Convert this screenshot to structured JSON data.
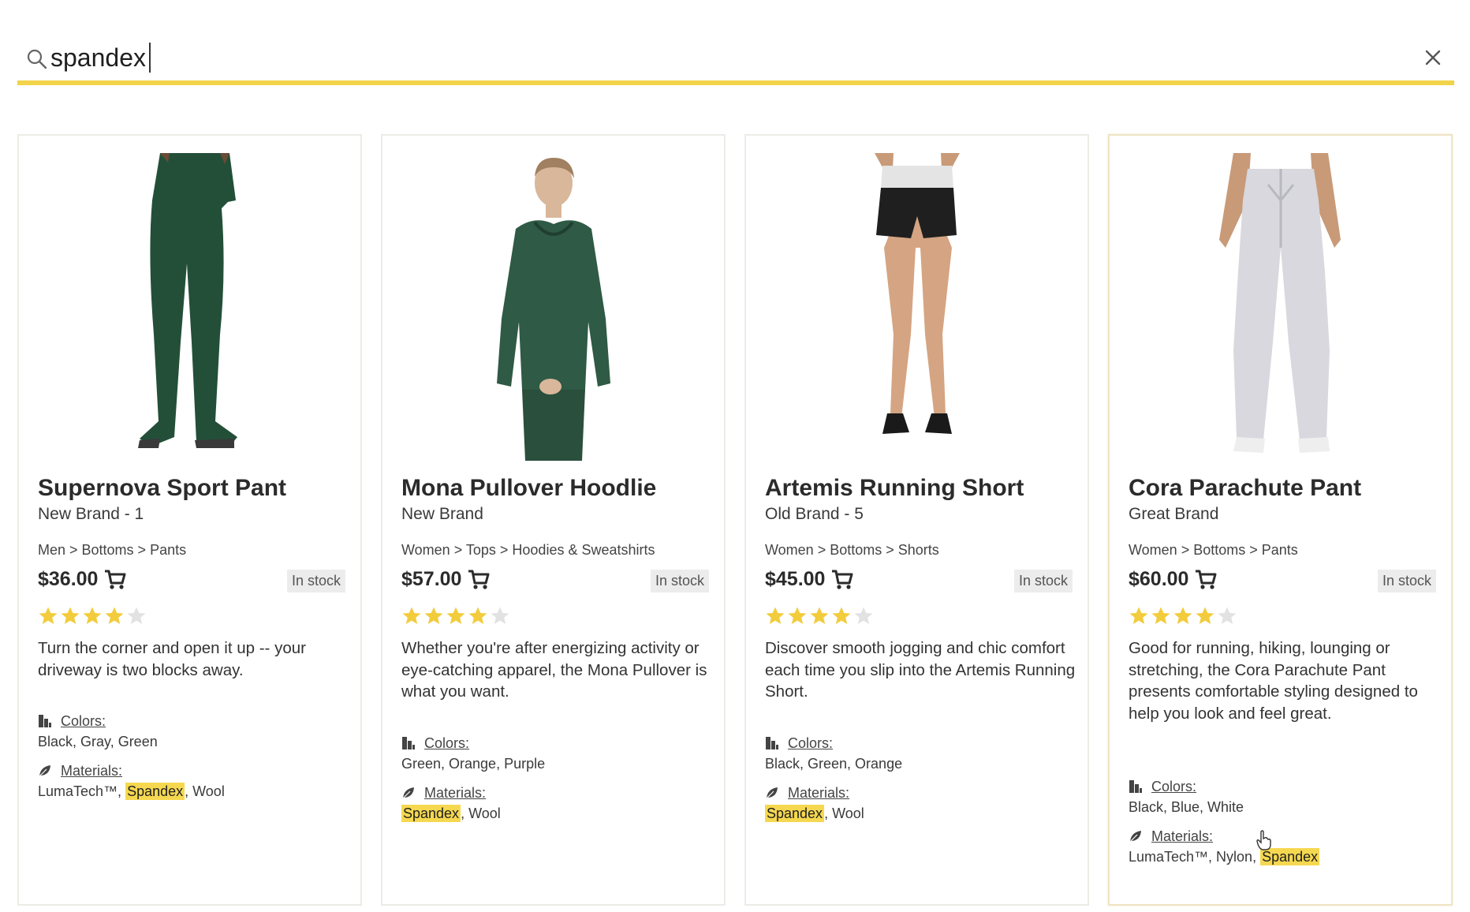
{
  "search": {
    "query": "spandex",
    "icons": {
      "search": "magnifier-icon",
      "clear": "close-x-icon"
    }
  },
  "colors": {
    "accent": "#f2d34a",
    "highlight": "#f5d850",
    "star": "#f2cc3c",
    "star_empty": "#e2e2e2"
  },
  "products": [
    {
      "title": "Supernova Sport Pant",
      "brand": "New Brand - 1",
      "breadcrumb": "Men > Bottoms > Pants",
      "price": "$36.00",
      "stock": "In stock",
      "rating": 4,
      "description": "Turn the corner and open it up -- your driveway is two blocks away.",
      "colors_label": "Colors:",
      "colors": "Black, Gray, Green",
      "materials_label": "Materials:",
      "materials_before": "LumaTech™, ",
      "materials_match": "Spandex",
      "materials_after": ", Wool"
    },
    {
      "title": "Mona Pullover Hoodlie",
      "brand": "New Brand",
      "breadcrumb": "Women > Tops > Hoodies & Sweatshirts",
      "price": "$57.00",
      "stock": "In stock",
      "rating": 4,
      "description": "Whether you're after energizing activity or eye-catching apparel, the Mona Pullover is what you want.",
      "colors_label": "Colors:",
      "colors": "Green, Orange, Purple",
      "materials_label": "Materials:",
      "materials_before": "",
      "materials_match": "Spandex",
      "materials_after": ", Wool"
    },
    {
      "title": "Artemis Running Short",
      "brand": "Old Brand - 5",
      "breadcrumb": "Women > Bottoms > Shorts",
      "price": "$45.00",
      "stock": "In stock",
      "rating": 4,
      "description": "Discover smooth jogging and chic comfort each time you slip into the Artemis Running Short.",
      "colors_label": "Colors:",
      "colors": "Black, Green, Orange",
      "materials_label": "Materials:",
      "materials_before": "",
      "materials_match": "Spandex",
      "materials_after": ", Wool"
    },
    {
      "title": "Cora Parachute Pant",
      "brand": "Great Brand",
      "breadcrumb": "Women > Bottoms > Pants",
      "price": "$60.00",
      "stock": "In stock",
      "rating": 4,
      "description": "Good for running, hiking, lounging or stretching, the Cora Parachute Pant presents comfortable styling designed to help you look and feel great.",
      "colors_label": "Colors:",
      "colors": "Black, Blue, White",
      "materials_label": "Materials:",
      "materials_before": "LumaTech™, Nylon, ",
      "materials_match": "Spandex",
      "materials_after": ""
    }
  ]
}
